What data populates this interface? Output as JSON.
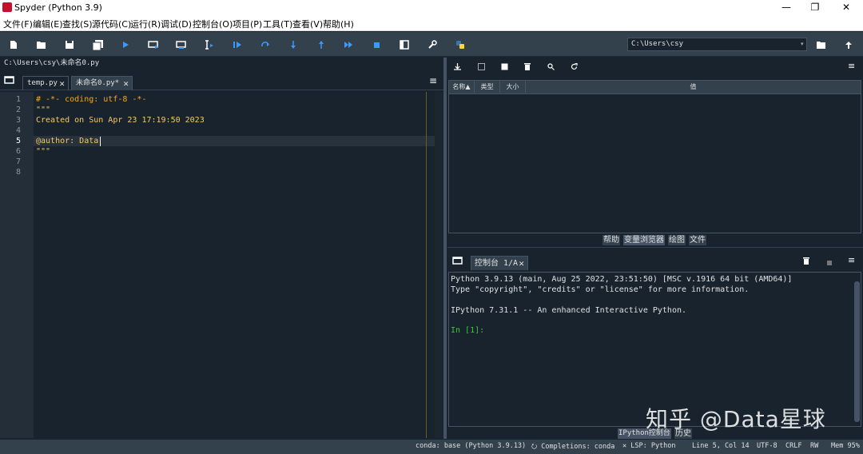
{
  "window": {
    "title": "Spyder (Python 3.9)",
    "minimize": "—",
    "maximize": "❐",
    "close": "✕"
  },
  "menu": [
    "文件(F)",
    "编辑(E)",
    "查找(S)",
    "源代码(C)",
    "运行(R)",
    "调试(D)",
    "控制台(O)",
    "项目(P)",
    "工具(T)",
    "查看(V)",
    "帮助(H)"
  ],
  "toolbar": {
    "path": "C:\\Users\\csy",
    "accent": "#3b99fc"
  },
  "editor": {
    "path": "C:\\Users\\csy\\未命名0.py",
    "tabs": [
      {
        "label": "temp.py"
      },
      {
        "label": "未命名0.py*"
      }
    ],
    "line_numbers": [
      "1",
      "2",
      "3",
      "4",
      "5",
      "6",
      "7",
      "8"
    ],
    "current_line": "5",
    "lines": [
      "# -*- coding: utf-8 -*-",
      "\"\"\"",
      "Created on Sun Apr 23 17:19:50 2023",
      "",
      "@author: Data",
      "\"\"\"",
      "",
      ""
    ]
  },
  "variable_explorer": {
    "columns": [
      "名称▲",
      "类型",
      "大小",
      "值"
    ],
    "panel_tabs": [
      "帮助",
      "变量浏览器",
      "绘图",
      "文件"
    ]
  },
  "console": {
    "tab_label": "控制台 1/A",
    "lines": [
      "Python 3.9.13 (main, Aug 25 2022, 23:51:50) [MSC v.1916 64 bit (AMD64)]",
      "Type \"copyright\", \"credits\" or \"license\" for more information.",
      "",
      "IPython 7.31.1 -- An enhanced Interactive Python.",
      "",
      "In [1]:"
    ],
    "bottom_tabs": [
      "IPython控制台",
      "历史"
    ]
  },
  "watermark": "知乎 @Data星球",
  "status": {
    "conda": "conda: base (Python 3.9.13)",
    "completions": "⭮ Completions: conda",
    "lsp": "✕ LSP: Python",
    "position": "Line 5, Col 14",
    "encoding": "UTF-8",
    "eol": "CRLF",
    "rw": "RW",
    "mem": "Mem 95%"
  }
}
